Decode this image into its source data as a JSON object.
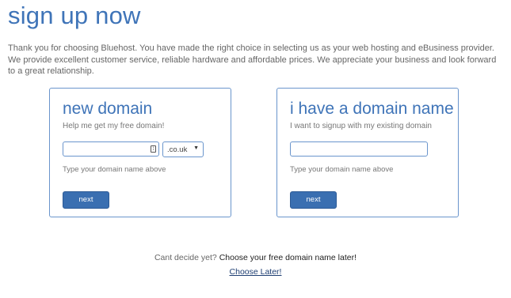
{
  "page": {
    "title": "sign up now",
    "intro": "Thank you for choosing Bluehost. You have made the right choice in selecting us as your web hosting and eBusiness provider. We provide excellent customer service, reliable hardware and affordable prices. We appreciate your business and look forward to a great relationship."
  },
  "new_domain": {
    "heading": "new domain",
    "subtitle": "Help me get my free domain!",
    "input_value": "",
    "input_icon": "password-key-icon",
    "tld_selected": ".co.uk",
    "hint": "Type your domain name above",
    "next_label": "next"
  },
  "existing_domain": {
    "heading": "i have a domain name",
    "subtitle": "I want to signup with my existing domain",
    "input_value": "",
    "hint": "Type your domain name above",
    "next_label": "next"
  },
  "footer": {
    "question": "Cant decide yet?",
    "question_bold": "Choose your free domain name later!",
    "link_label": "Choose Later!"
  },
  "colors": {
    "accent": "#3f74b8",
    "button": "#3a6fb1",
    "border": "#6a95cc"
  }
}
